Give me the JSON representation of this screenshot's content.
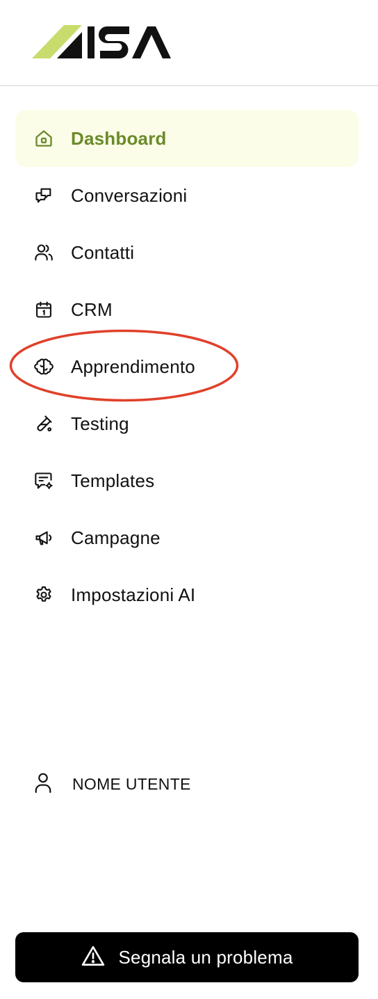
{
  "brand": {
    "logo_text": "ISA",
    "accent_color": "#c8dc6e"
  },
  "nav": {
    "items": [
      {
        "label": "Dashboard",
        "icon": "home-icon",
        "active": true
      },
      {
        "label": "Conversazioni",
        "icon": "chat-bubbles-icon"
      },
      {
        "label": "Contatti",
        "icon": "users-icon"
      },
      {
        "label": "CRM",
        "icon": "calendar-icon"
      },
      {
        "label": "Apprendimento",
        "icon": "brain-icon",
        "highlighted": true
      },
      {
        "label": "Testing",
        "icon": "flask-icon"
      },
      {
        "label": "Templates",
        "icon": "message-settings-icon"
      },
      {
        "label": "Campagne",
        "icon": "megaphone-icon"
      },
      {
        "label": "Impostazioni AI",
        "icon": "gear-icon"
      }
    ],
    "active_color": "#6b8a2a",
    "active_background": "#fbfde8"
  },
  "user": {
    "name": "NOME UTENTE",
    "icon": "user-icon"
  },
  "report_button": {
    "label": "Segnala un problema",
    "icon": "warning-icon"
  },
  "annotation": {
    "color": "#e0402a"
  }
}
